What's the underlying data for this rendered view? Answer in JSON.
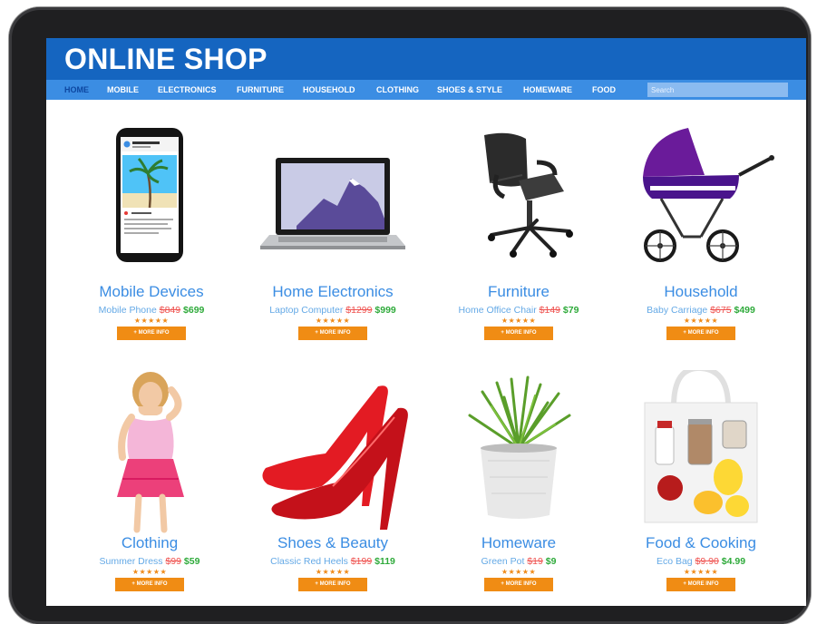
{
  "shop": {
    "title": "ONLINE SHOP"
  },
  "nav": {
    "items": [
      "HOME",
      "MOBILE",
      "ELECTRONICS",
      "FURNITURE",
      "HOUSEHOLD",
      "CLOTHING",
      "SHOES & STYLE",
      "HOMEWARE",
      "FOOD"
    ],
    "active": "HOME",
    "search_placeholder": "Search"
  },
  "products": [
    {
      "category": "Mobile Devices",
      "name": "Mobile Phone",
      "old_price": "$849",
      "new_price": "$699",
      "rating": "★★★★★",
      "button": "+ MORE INFO"
    },
    {
      "category": "Home Electronics",
      "name": "Laptop Computer",
      "old_price": "$1299",
      "new_price": "$999",
      "rating": "★★★★★",
      "button": "+ MORE INFO"
    },
    {
      "category": "Furniture",
      "name": "Home Office Chair",
      "old_price": "$149",
      "new_price": "$79",
      "rating": "★★★★★",
      "button": "+ MORE INFO"
    },
    {
      "category": "Household",
      "name": "Baby Carriage",
      "old_price": "$675",
      "new_price": "$499",
      "rating": "★★★★★",
      "button": "+ MORE INFO"
    },
    {
      "category": "Clothing",
      "name": "Summer Dress",
      "old_price": "$99",
      "new_price": "$59",
      "rating": "★★★★★",
      "button": "+ MORE INFO"
    },
    {
      "category": "Shoes & Beauty",
      "name": "Classic Red Heels",
      "old_price": "$199",
      "new_price": "$119",
      "rating": "★★★★★",
      "button": "+ MORE INFO"
    },
    {
      "category": "Homeware",
      "name": "Green Pot",
      "old_price": "$19",
      "new_price": "$9",
      "rating": "★★★★★",
      "button": "+ MORE INFO"
    },
    {
      "category": "Food & Cooking",
      "name": "Eco Bag",
      "old_price": "$9.90",
      "new_price": "$4.99",
      "rating": "★★★★★",
      "button": "+ MORE INFO"
    }
  ],
  "colors": {
    "header": "#1565c0",
    "navbar": "#3b8de3",
    "button": "#f08c14",
    "category_text": "#3b8de3",
    "old_price": "#ef5350",
    "new_price": "#2eaa3a"
  }
}
